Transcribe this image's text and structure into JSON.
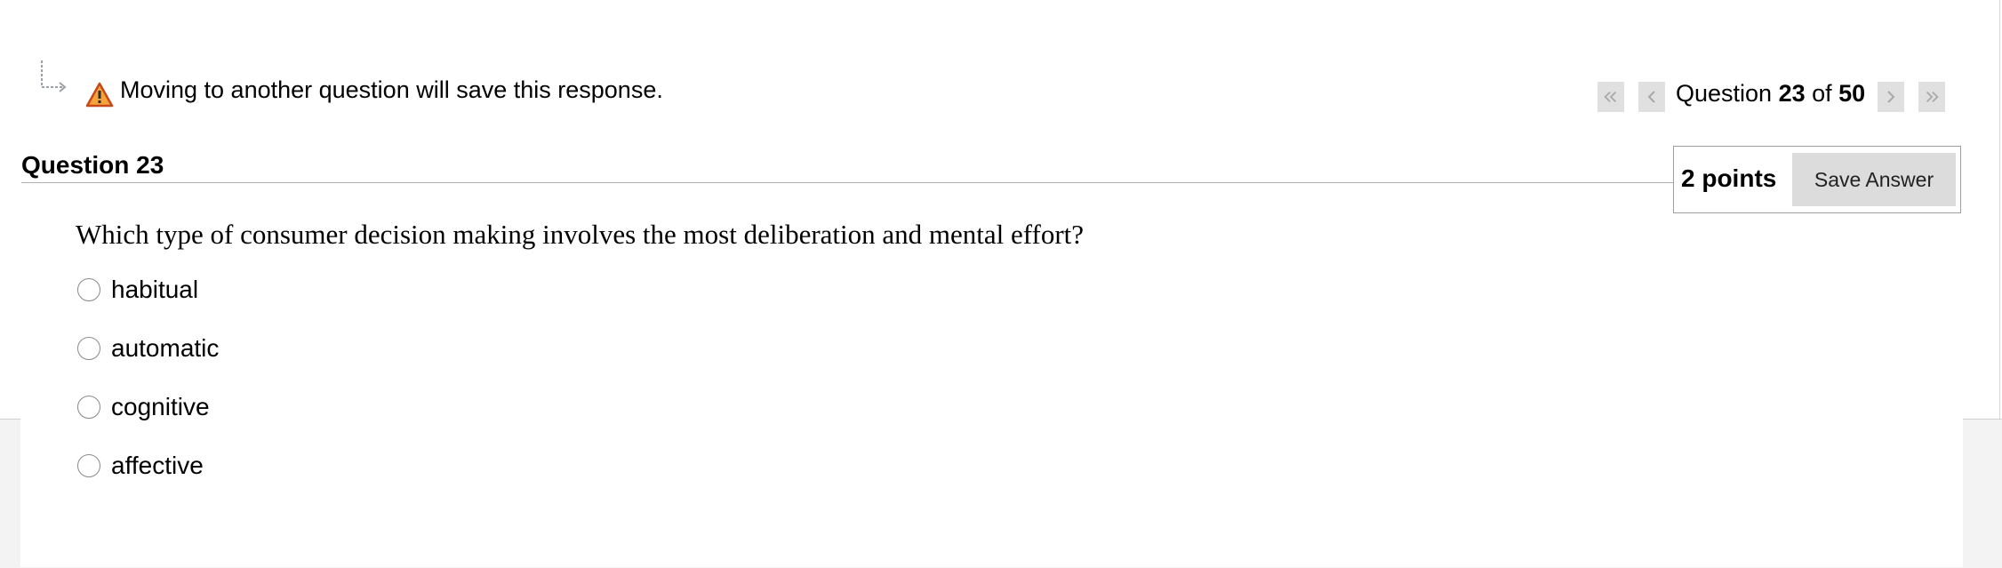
{
  "warning": {
    "icon": "warning-icon",
    "text": "Moving to another question will save this response."
  },
  "navigation": {
    "label_prefix": "Question ",
    "current": "23",
    "label_of": " of ",
    "total": "50",
    "buttons": [
      "first-page-icon",
      "previous-page-icon",
      "next-page-icon",
      "last-page-icon"
    ]
  },
  "question": {
    "title": "Question 23",
    "points": "2 points",
    "save_label": "Save Answer",
    "text": "Which type of consumer decision making involves the most deliberation and mental effort?",
    "options": [
      "habitual",
      "automatic",
      "cognitive",
      "affective"
    ]
  },
  "colors": {
    "warning_orange": "#e8671c",
    "nav_button_bg": "#e0e0e0",
    "save_button_bg": "#dcdcdc"
  }
}
